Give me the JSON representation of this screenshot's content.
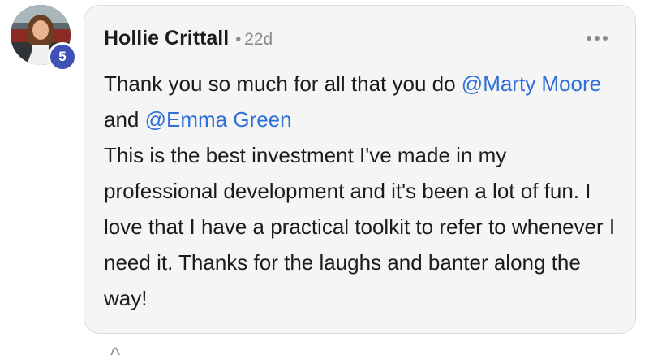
{
  "comment": {
    "author": "Hollie Crittall",
    "separator": "•",
    "timestamp": "22d",
    "level": "5",
    "line1_text": "Thank you so much for all that you do ",
    "mention1": "@Marty Moore",
    "and_text": " and ",
    "mention2": "@Emma Green",
    "paragraph2": "This is the best investment I've made in my professional development and it's been a lot of fun. I love that I have a practical toolkit to refer to whenever I need it. Thanks for the laughs and banter along the way!"
  },
  "icons": {
    "more": "more-horizontal-icon",
    "below": "like-icon"
  },
  "colors": {
    "mention": "#2f6fd8",
    "badge": "#3f51b5",
    "card_bg": "#f5f5f5",
    "muted": "#8a8a8a"
  }
}
